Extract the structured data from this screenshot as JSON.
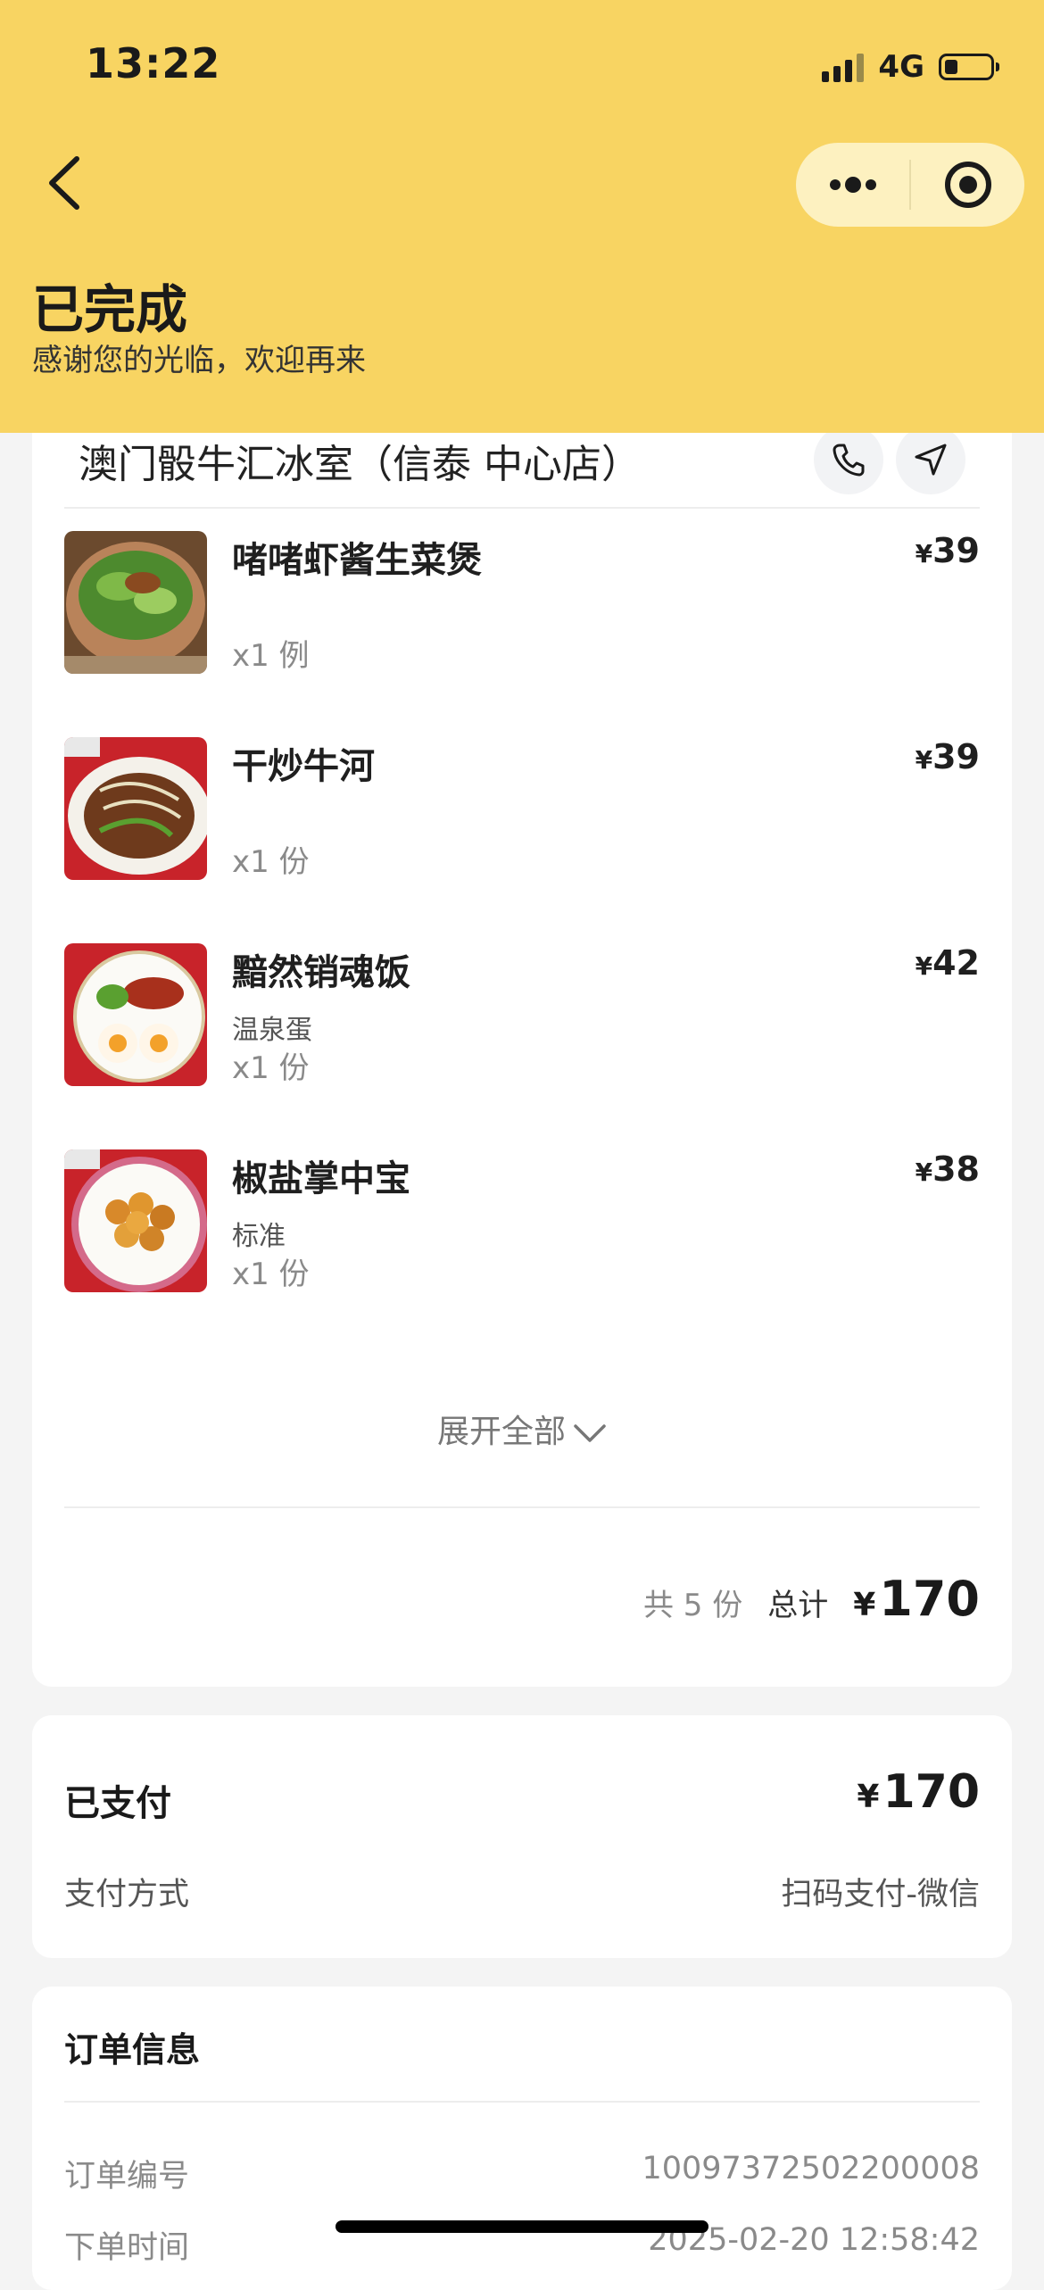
{
  "status_bar": {
    "time": "13:22",
    "network": "4G",
    "battery_level": 0.3
  },
  "nav": {
    "back_icon": "chevron-left-icon",
    "more_icon": "more-dots-icon",
    "close_icon": "target-circle-icon"
  },
  "order_status": {
    "title": "已完成",
    "subtitle": "感谢您的光临，欢迎再来"
  },
  "store": {
    "name": "澳门骰牛汇冰室（信泰 中心店）",
    "phone_icon": "phone-icon",
    "nav_icon": "navigate-arrow-icon"
  },
  "items": [
    {
      "name": "啫啫虾酱生菜煲",
      "spec": "",
      "qty": "x1 例",
      "currency": "¥",
      "price": "39"
    },
    {
      "name": "干炒牛河",
      "spec": "",
      "qty": "x1 份",
      "currency": "¥",
      "price": "39"
    },
    {
      "name": "黯然销魂饭",
      "spec": "温泉蛋",
      "qty": "x1 份",
      "currency": "¥",
      "price": "42"
    },
    {
      "name": "椒盐掌中宝",
      "spec": "标准",
      "qty": "x1 份",
      "currency": "¥",
      "price": "38"
    }
  ],
  "expand_label": "展开全部",
  "summary": {
    "count": "共 5 份",
    "total_label": "总计",
    "currency": "¥",
    "total": "170"
  },
  "payment": {
    "label": "已支付",
    "currency": "¥",
    "amount": "170",
    "method_label": "支付方式",
    "method_value": "扫码支付-微信"
  },
  "order_info": {
    "title": "订单信息",
    "rows": [
      {
        "label": "订单编号",
        "value": "10097372502200008"
      },
      {
        "label": "下单时间",
        "value": "2025-02-20 12:58:42"
      }
    ]
  },
  "colors": {
    "header_bg": "#f8d462",
    "capsule_bg": "#fdf1c0",
    "page_bg": "#f4f4f4"
  }
}
